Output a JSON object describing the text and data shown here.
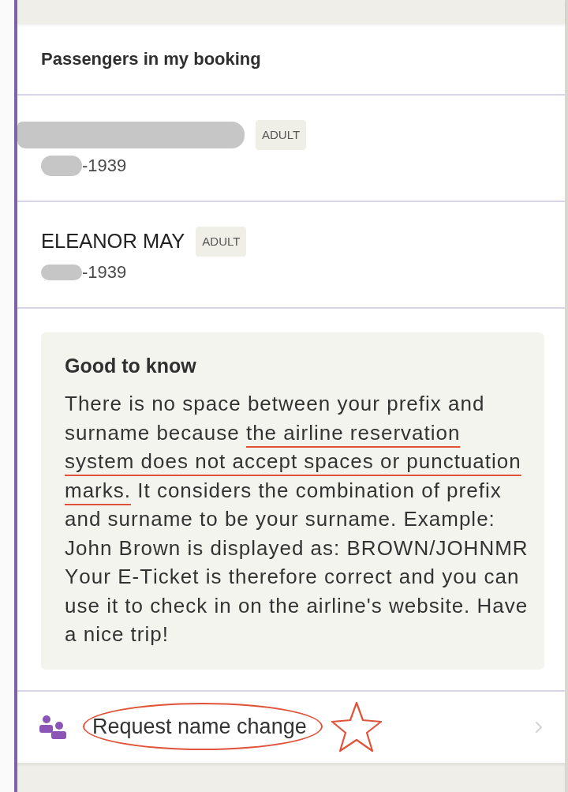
{
  "section_title": "Passengers in my booking",
  "passengers": [
    {
      "name_redacted": true,
      "type": "ADULT",
      "birth_date": "-1939",
      "birth_date_redacted": true
    },
    {
      "name": "ELEANOR MAY",
      "name_redacted": false,
      "type": "ADULT",
      "birth_date": "-1939",
      "birth_date_redacted": true
    }
  ],
  "notice": {
    "title": "Good to know",
    "body": [
      {
        "text": "There is no space between your prefix and surname because ",
        "underlined": false
      },
      {
        "text": "the airline reservation system does not accept spaces or punctuation marks.",
        "underlined": true
      },
      {
        "text": " It considers the combination of prefix and surname to be your surname. Example: John Brown is displayed as: BROWN/JOHNMR Your E-Ticket is therefore correct and you can use it to check in on the airline's website. Have a nice trip!",
        "underlined": false
      }
    ]
  },
  "action": {
    "label": "Request name change",
    "circled": true,
    "starred": true
  }
}
